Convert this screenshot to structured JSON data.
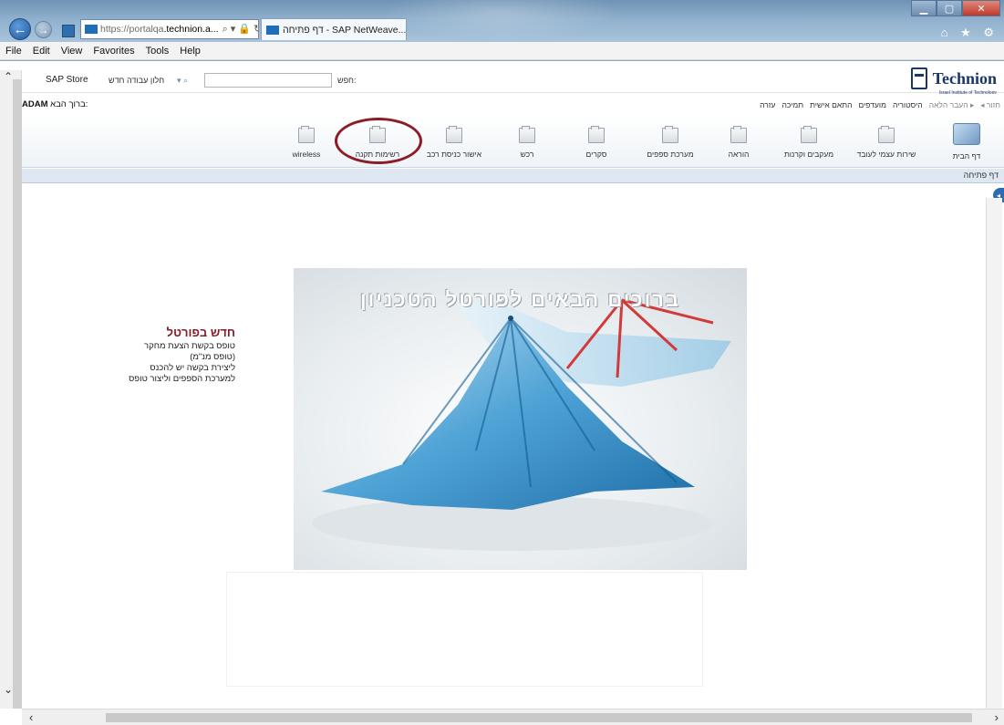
{
  "browser": {
    "address_url_prefix": "https://",
    "address_url_host_muted": "portalqa",
    "address_url_host_strong": ".technion.a...",
    "address_tools": "⌕ ▾ 🔒 ↻",
    "tab_title": "דף פתיחה - SAP NetWeave...",
    "tab_close": "×",
    "back_glyph": "←",
    "forward_glyph": "→",
    "right_icons": "⌂ ★ ⚙",
    "menu": [
      "File",
      "Edit",
      "View",
      "Favorites",
      "Tools",
      "Help"
    ]
  },
  "sap_header": {
    "sap_store": "SAP Store",
    "new_window": "חלון עבודה חדש",
    "search_dropdown": "▾ ⌕",
    "search_placeholder": "",
    "search_label": "חפש:",
    "logo_text": "Technion",
    "logo_sub": "Israel Institute of Technology",
    "welcome_prefix": "ברוך הבא:",
    "welcome_user": "ADAM",
    "nav_links": [
      "◂ חזור",
      "העבר הלאה ▸",
      "היסטוריה",
      "מועדפים",
      "התאם אישית",
      "תמיכה",
      "עזרה"
    ]
  },
  "top_nav": {
    "items": [
      "wireless",
      "רשימות תקנה",
      "אישור כניסת רכב",
      "רכש",
      "סקרים",
      "מערכת ספפים",
      "הוראה",
      "מעקבים וקרנות",
      "שירות עצמי לעובד",
      "דף הבית"
    ],
    "highlighted_item": "רשימות תקנה"
  },
  "breadcrumb": "דף פתיחה",
  "news": {
    "title": "חדש בפורטל",
    "lines": [
      "טופס בקשת הצעת מחקר",
      "(טופס מנ\"מ)",
      "ליצירת בקשה יש להכנס",
      "למערכת הספפים וליצור טופס"
    ]
  },
  "hero": {
    "headline": "ברוכים הבאים לפורטל הטכניון"
  },
  "colors": {
    "highlight_circle": "#8c1c25",
    "news_title": "#8b1a24",
    "brand_blue": "#1b3766"
  }
}
